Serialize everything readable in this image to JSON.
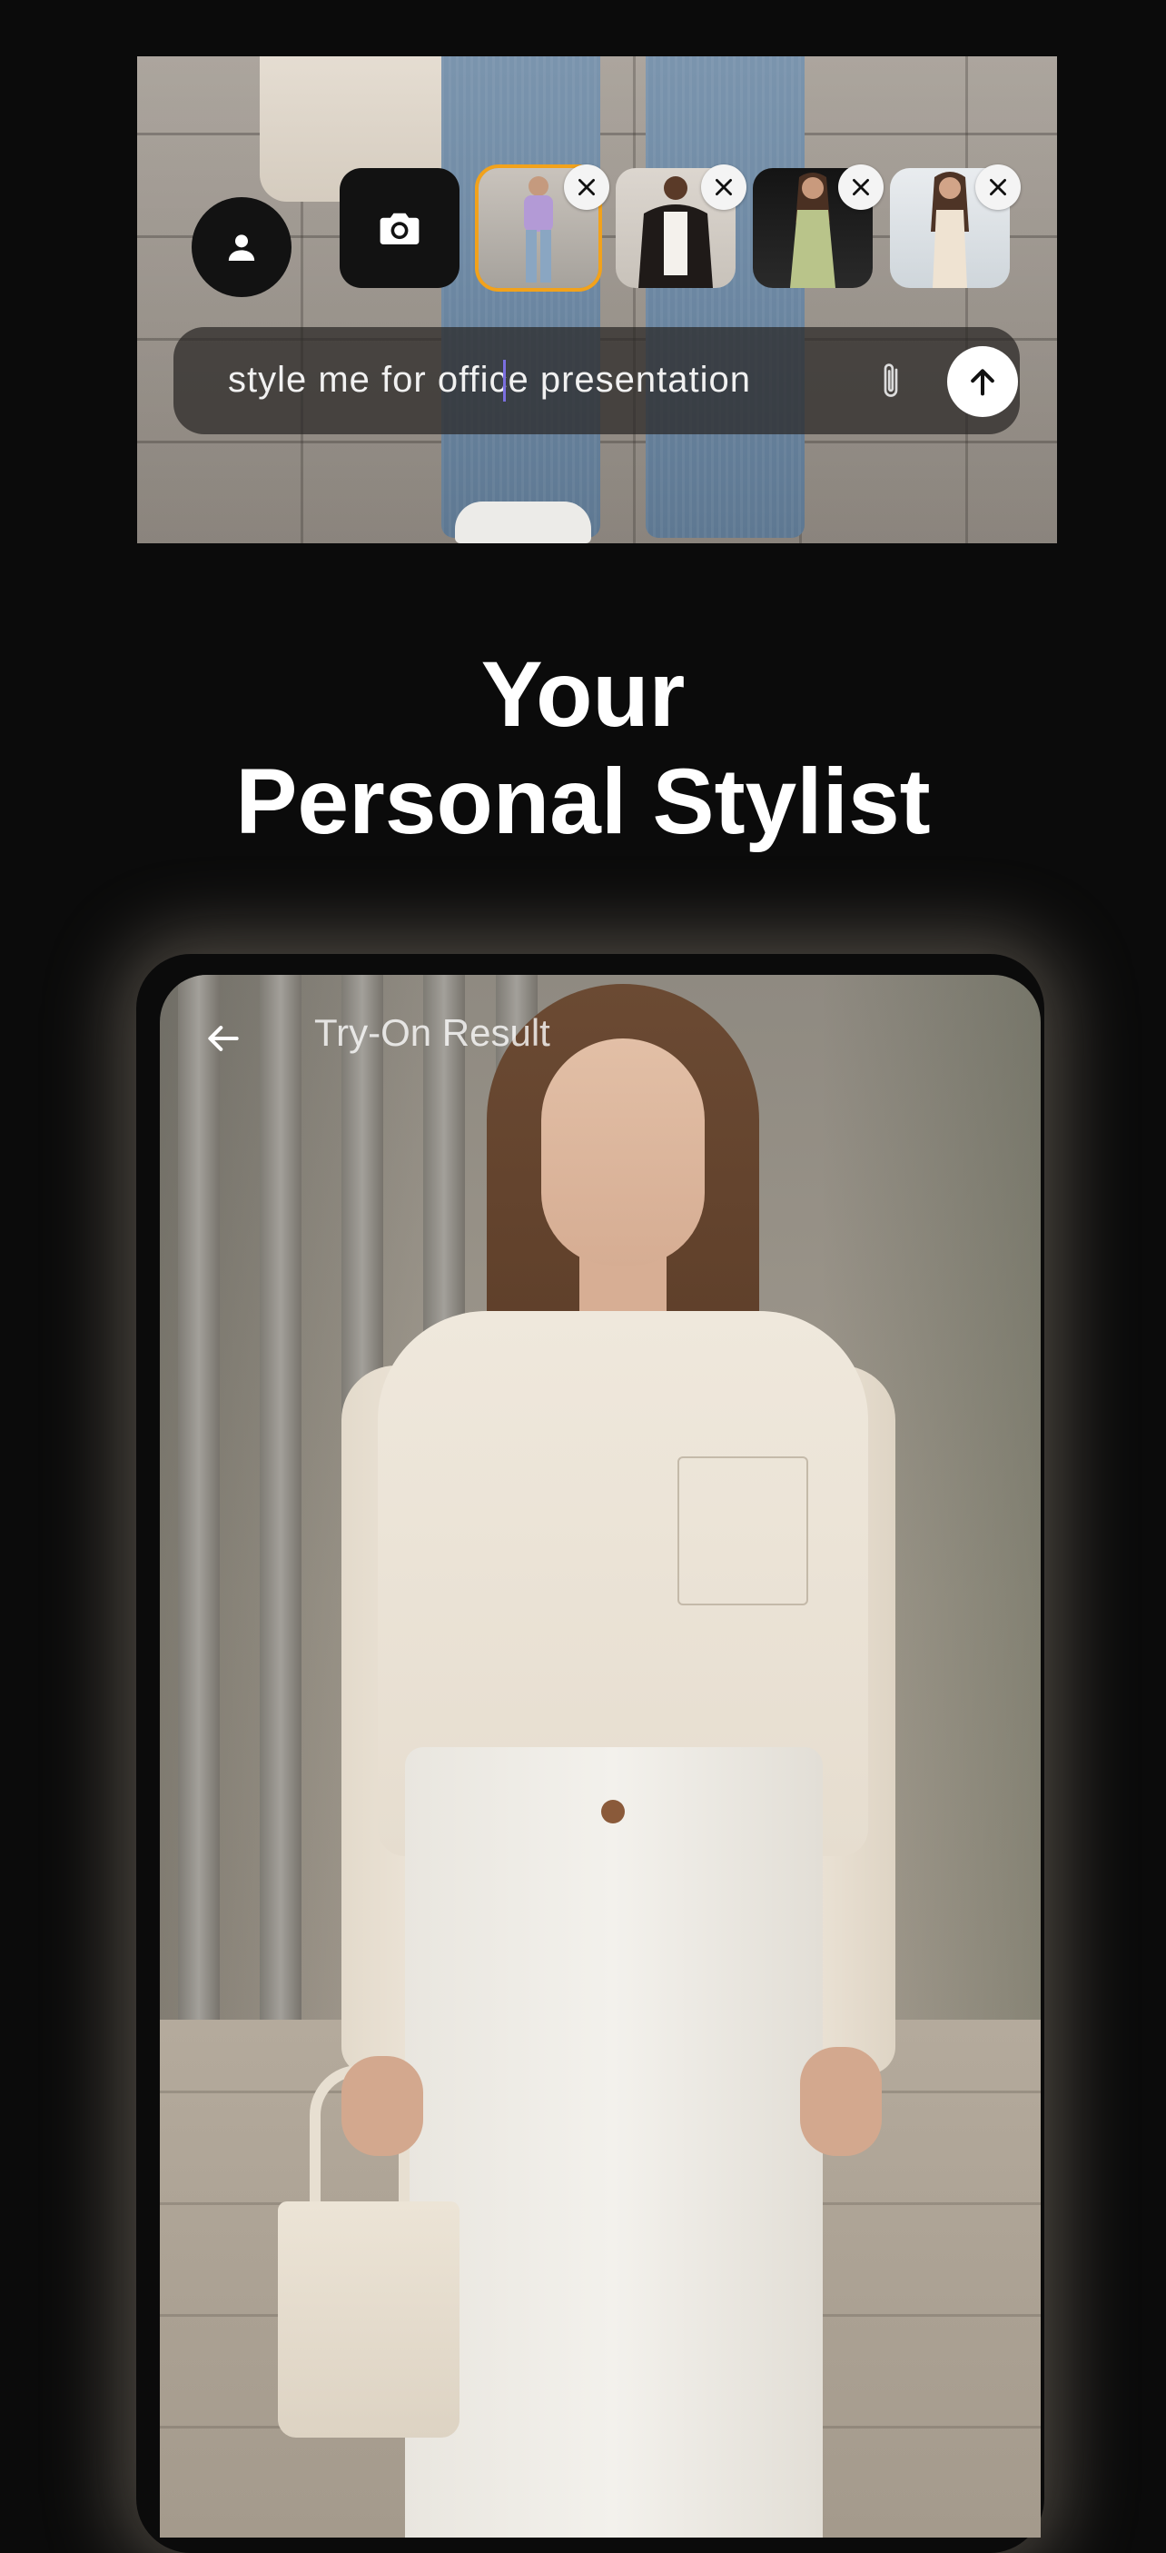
{
  "composer": {
    "input_value": "style me for office presentation",
    "send_icon": "arrow-up-icon",
    "attach_icon": "paperclip-icon"
  },
  "toolbar": {
    "profile_icon": "person-icon",
    "camera_icon": "camera-icon",
    "thumbnails": [
      {
        "name": "outfit-thumbnail-1",
        "selected": true
      },
      {
        "name": "outfit-thumbnail-2",
        "selected": false
      },
      {
        "name": "outfit-thumbnail-3",
        "selected": false
      },
      {
        "name": "outfit-thumbnail-4",
        "selected": false
      }
    ],
    "selected_color": "#f2a21b"
  },
  "headline": {
    "line1": "Your",
    "line2": "Personal Stylist"
  },
  "result": {
    "title": "Try-On Result",
    "back_icon": "arrow-left-icon"
  },
  "colors": {
    "background": "#0b0b0b",
    "text": "#ffffff"
  }
}
